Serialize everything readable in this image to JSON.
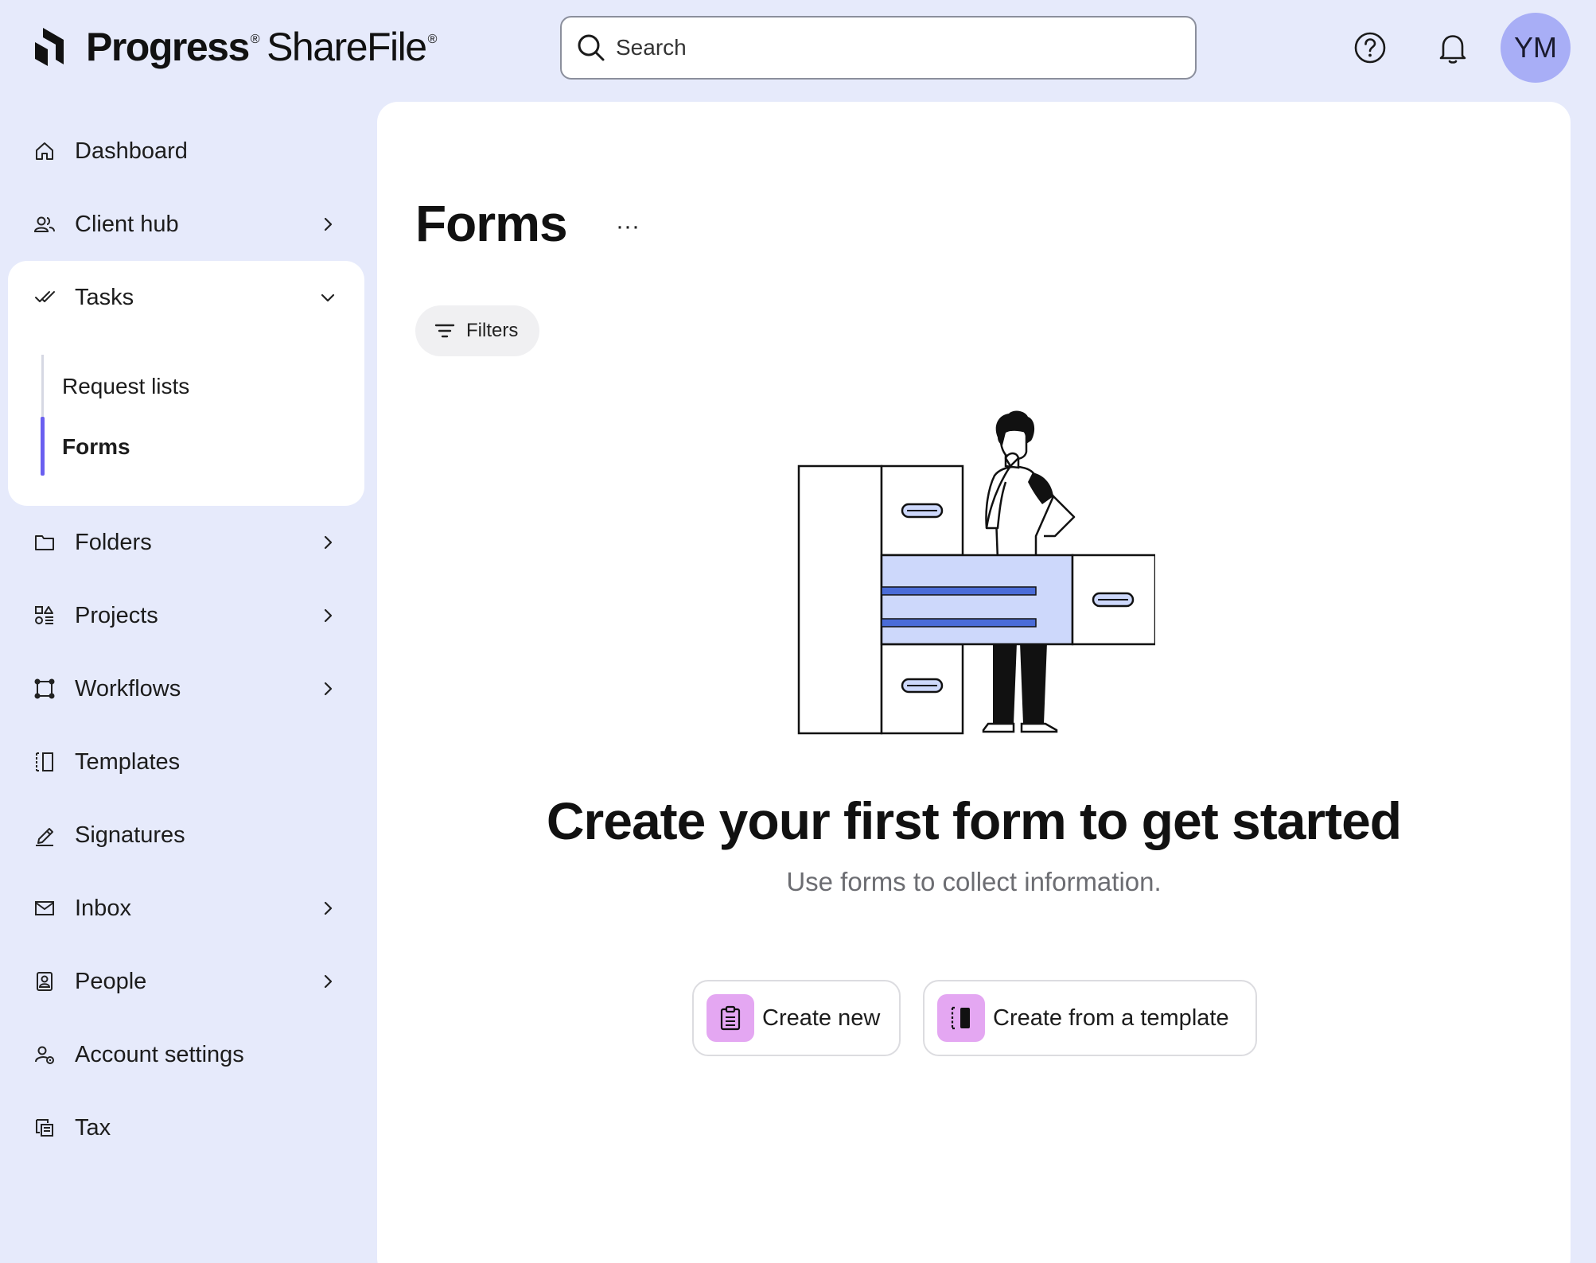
{
  "header": {
    "logo_primary": "Progress",
    "logo_secondary": "ShareFile",
    "logo_mark": "®",
    "search_placeholder": "Search",
    "help_icon": "help-circle-icon",
    "notifications_icon": "bell-icon",
    "avatar_initials": "YM"
  },
  "sidebar": {
    "items": [
      {
        "label": "Dashboard",
        "icon": "home-icon"
      },
      {
        "label": "Client hub",
        "icon": "client-hub-icon"
      },
      {
        "label": "Tasks",
        "icon": "tasks-check-icon"
      },
      {
        "label": "Folders",
        "icon": "folder-icon"
      },
      {
        "label": "Projects",
        "icon": "projects-icon"
      },
      {
        "label": "Workflows",
        "icon": "workflows-icon"
      },
      {
        "label": "Templates",
        "icon": "templates-icon"
      },
      {
        "label": "Signatures",
        "icon": "signature-pen-icon"
      },
      {
        "label": "Inbox",
        "icon": "mail-icon"
      },
      {
        "label": "People",
        "icon": "people-icon"
      },
      {
        "label": "Account settings",
        "icon": "account-settings-icon"
      },
      {
        "label": "Tax",
        "icon": "tax-icon"
      }
    ],
    "tasks_subitems": [
      {
        "label": "Request lists"
      },
      {
        "label": "Forms"
      }
    ]
  },
  "main": {
    "title": "Forms",
    "more_label": "···",
    "filters_label": "Filters",
    "empty_title": "Create your first form to get started",
    "empty_subtitle": "Use forms to collect information.",
    "create_new_label": "Create new",
    "create_template_label": "Create from a template"
  },
  "colors": {
    "background": "#e6eafb",
    "active_indicator": "#6a5ff0",
    "avatar": "#a8aef6",
    "button_icon_bg": "#e4a7f2",
    "illustration_accent": "#cdd8fb"
  }
}
